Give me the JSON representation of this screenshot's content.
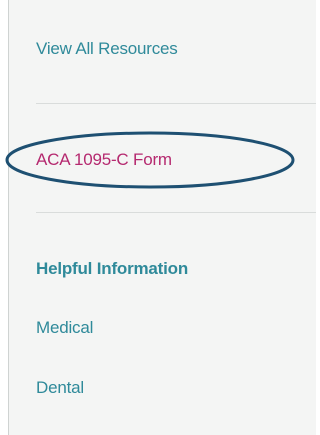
{
  "sidebar": {
    "items": [
      {
        "label": "View All Resources",
        "active": false
      },
      {
        "label": "ACA 1095-C Form",
        "active": true
      }
    ],
    "section_title": "Helpful Information",
    "section_items": [
      {
        "label": "Medical"
      },
      {
        "label": "Dental"
      }
    ]
  },
  "colors": {
    "link": "#2f8a9a",
    "active_link": "#b5296f",
    "annotation": "#1e5072",
    "panel_bg": "#f4f5f4"
  }
}
